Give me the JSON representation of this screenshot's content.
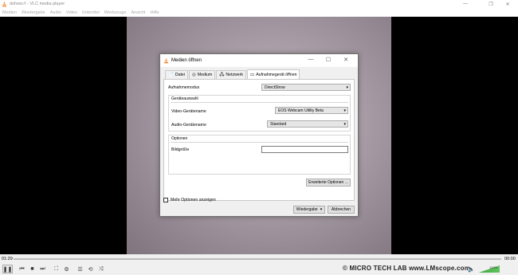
{
  "window": {
    "title": "dshow:// - VLC media player",
    "controls": {
      "minimize": "—",
      "maximize": "❐",
      "close": "✕"
    }
  },
  "menu": [
    "Medien",
    "Wiedergabe",
    "Audio",
    "Video",
    "Untertitel",
    "Werkzeuge",
    "Ansicht",
    "Hilfe"
  ],
  "dialog": {
    "title": "Medien öffnen",
    "controls": {
      "minimize": "—",
      "maximize": "☐",
      "close": "✕"
    },
    "tabs": [
      {
        "label": "Datei",
        "icon": "file-icon",
        "glyph": "📄"
      },
      {
        "label": "Medium",
        "icon": "disc-icon",
        "glyph": "◎"
      },
      {
        "label": "Netzwerk",
        "icon": "network-icon",
        "glyph": "🖧"
      },
      {
        "label": "Aufnahmegerät öffnen",
        "icon": "capture-device-icon",
        "glyph": "▭",
        "active": true
      }
    ],
    "capture_mode": {
      "label": "Aufnahmemodus",
      "value": "DirectShow"
    },
    "device_group": {
      "title": "Geräteauswahl",
      "video": {
        "label": "Video-Gerätename",
        "value": "EOS Webcam Utility Beta"
      },
      "audio": {
        "label": "Audio-Gerätename",
        "value": "Standard"
      }
    },
    "options_group": {
      "title": "Optionen",
      "image_size": {
        "label": "Bildgröße",
        "value": ""
      }
    },
    "advanced_button": "Erweiterte Optionen ...",
    "show_more": {
      "label": "Mehr Optionen anzeigen",
      "checked": false
    },
    "play_button": "Wiedergabe",
    "cancel_button": "Abbrechen"
  },
  "player": {
    "elapsed": "01:29",
    "remaining": "00:00",
    "progress": 0.98,
    "brand_text": "©  MICRO TECH LAB     www.LMscope.com",
    "volume_label": "100%",
    "volume": 1.0,
    "accent": "#3c8ee8",
    "controls": [
      {
        "name": "pause-button",
        "glyph": "❚❚"
      },
      {
        "name": "previous-button",
        "glyph": "⏮"
      },
      {
        "name": "stop-button",
        "glyph": "■"
      },
      {
        "name": "next-button",
        "glyph": "⏭"
      },
      {
        "name": "fullscreen-button",
        "glyph": "⛶"
      },
      {
        "name": "extended-settings-button",
        "glyph": "⚙"
      },
      {
        "name": "playlist-button",
        "glyph": "☰"
      },
      {
        "name": "loop-button",
        "glyph": "⟲"
      },
      {
        "name": "shuffle-button",
        "glyph": "⤨"
      }
    ]
  }
}
